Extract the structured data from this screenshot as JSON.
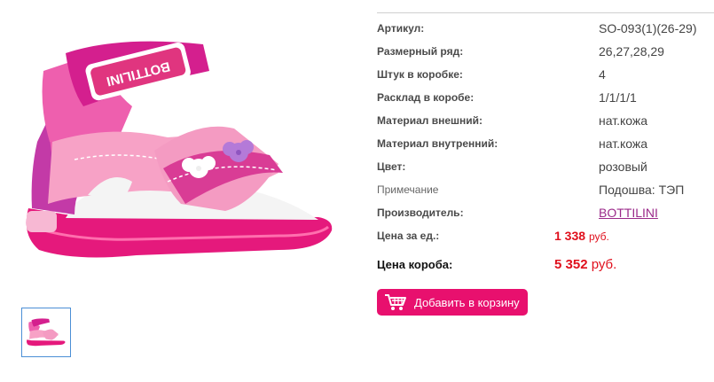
{
  "product": {
    "image_alt": "pink sandal",
    "thumbnail_alt": "pink sandal thumbnail",
    "brand_print": "BOTTILINI"
  },
  "specs": [
    {
      "label": "Артикул:",
      "value": "SO-093(1)(26-29)"
    },
    {
      "label": "Размерный ряд:",
      "value": "26,27,28,29"
    },
    {
      "label": "Штук в коробке:",
      "value": "4"
    },
    {
      "label": "Расклад в коробе:",
      "value": "1/1/1/1"
    },
    {
      "label": "Материал внешний:",
      "value": "нат.кожа"
    },
    {
      "label": "Материал внутренний:",
      "value": "нат.кожа"
    },
    {
      "label": "Цвет:",
      "value": "розовый"
    },
    {
      "label": "Примечание",
      "value": "Подошва: ТЭП"
    },
    {
      "label": "Производитель:",
      "value": "BOTTILINI"
    }
  ],
  "price_unit": {
    "label": "Цена за ед.:",
    "amount": "1 338",
    "currency": "руб."
  },
  "price_box": {
    "label": "Цена короба:",
    "amount": "5 352",
    "currency": "руб."
  },
  "cart_button": {
    "label": "Добавить в корзину",
    "icon": "cart-icon"
  },
  "colors": {
    "accent": "#e8106e",
    "price": "#e0101d",
    "link": "#9b2a8a",
    "thumb_border": "#4b8fd6"
  }
}
